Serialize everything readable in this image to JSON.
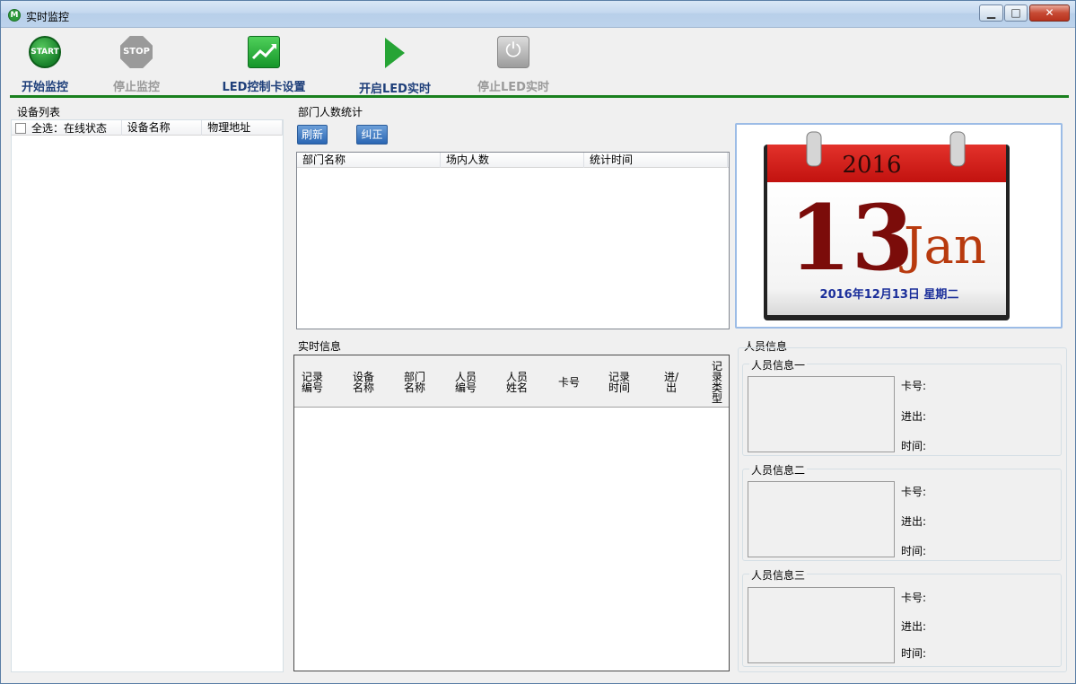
{
  "window": {
    "title": "实时监控"
  },
  "toolbar": {
    "start_label": "开始监控",
    "start_icon_text": "START",
    "stop_label": "停止监控",
    "stop_icon_text": "STOP",
    "led_settings_label": "LED控制卡设置",
    "open_led_label": "开启LED实时",
    "stop_led_label": "停止LED实时"
  },
  "device_list": {
    "title": "设备列表",
    "columns": [
      "全选：在线状态",
      "设备名称",
      "物理地址"
    ]
  },
  "dept_stats": {
    "title": "部门人数统计",
    "refresh_label": "刷新",
    "correct_label": "纠正",
    "columns": [
      "部门名称",
      "场内人数",
      "统计时间"
    ]
  },
  "calendar": {
    "year": "2016",
    "day": "13",
    "month": "Jan",
    "date_line": "2016年12月13日  星期二"
  },
  "realtime": {
    "title": "实时信息",
    "columns": [
      "记录编号",
      "设备名称",
      "部门名称",
      "人员编号",
      "人员姓名",
      "卡号",
      "记录时间",
      "进/出",
      "记录类型"
    ]
  },
  "persons": {
    "title": "人员信息",
    "items": [
      {
        "title": "人员信息一",
        "card_label": "卡号:",
        "inout_label": "进出:",
        "time_label": "时间:"
      },
      {
        "title": "人员信息二",
        "card_label": "卡号:",
        "inout_label": "进出:",
        "time_label": "时间:"
      },
      {
        "title": "人员信息三",
        "card_label": "卡号:",
        "inout_label": "进出:",
        "time_label": "时间:"
      }
    ]
  }
}
